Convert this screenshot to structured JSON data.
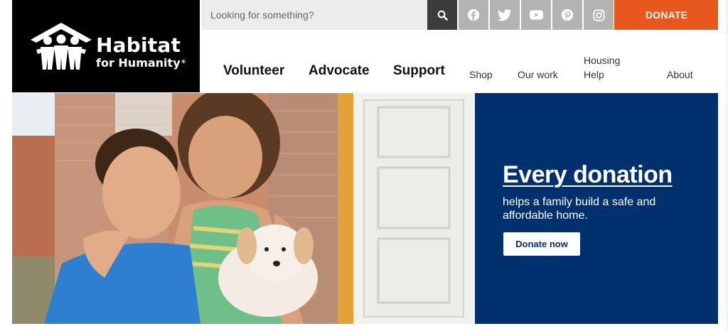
{
  "brand": {
    "name_line1": "Habitat",
    "name_line2": "for Humanity",
    "registered": "®",
    "colors": {
      "logo_bg": "#000000",
      "accent": "#e8571e",
      "hero_blue": "#00306e"
    }
  },
  "search": {
    "placeholder": "Looking for something?",
    "icon": "search-icon"
  },
  "social": [
    {
      "name": "facebook",
      "icon": "facebook-icon"
    },
    {
      "name": "twitter",
      "icon": "twitter-icon"
    },
    {
      "name": "youtube",
      "icon": "youtube-icon"
    },
    {
      "name": "pinterest",
      "icon": "pinterest-icon"
    },
    {
      "name": "instagram",
      "icon": "instagram-icon"
    }
  ],
  "header": {
    "donate_label": "DONATE"
  },
  "nav": {
    "primary": [
      "Volunteer",
      "Advocate",
      "Support"
    ],
    "secondary": {
      "shop": "Shop",
      "our_work": "Our work",
      "housing_help_line1": "Housing",
      "housing_help_line2": "Help",
      "about": "About"
    }
  },
  "hero": {
    "title": "Every donation",
    "text": "helps a family build a safe and affordable home.",
    "button_label": "Donate now",
    "image": "photo of two smiling children holding a puppy"
  }
}
